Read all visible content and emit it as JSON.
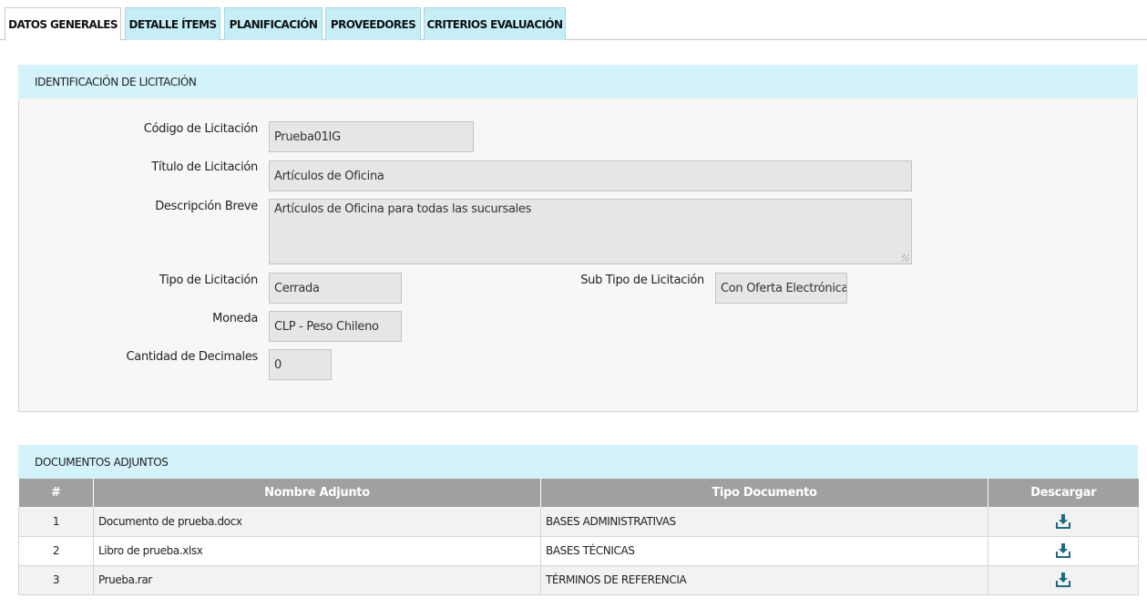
{
  "tabs": [
    {
      "label": "DATOS GENERALES",
      "active": true
    },
    {
      "label": "DETALLE ÍTEMS",
      "active": false
    },
    {
      "label": "PLANIFICACIÓN",
      "active": false
    },
    {
      "label": "PROVEEDORES",
      "active": false
    },
    {
      "label": "CRITERIOS EVALUACIÓN",
      "active": false
    }
  ],
  "identificacion": {
    "header": "IDENTIFICACIÓN DE LICITACIÓN",
    "codigo_label": "Código de Licitación",
    "codigo_value": "Prueba01IG",
    "titulo_label": "Título de Licitación",
    "titulo_value": "Artículos de Oficina",
    "descripcion_label": "Descripción Breve",
    "descripcion_value": "Artículos de Oficina para todas las sucursales",
    "tipo_label": "Tipo de Licitación",
    "tipo_value": "Cerrada",
    "subtipo_label": "Sub Tipo de Licitación",
    "subtipo_value": "Con Oferta Electrónica",
    "moneda_label": "Moneda",
    "moneda_value": "CLP - Peso Chileno",
    "decimales_label": "Cantidad de Decimales",
    "decimales_value": "0"
  },
  "documentos": {
    "header": "DOCUMENTOS ADJUNTOS",
    "columns": [
      "#",
      "Nombre Adjunto",
      "Tipo Documento",
      "Descargar"
    ],
    "rows": [
      {
        "num": "1",
        "nombre": "Documento de prueba.docx",
        "tipo": "BASES ADMINISTRATIVAS",
        "icon": "download-icon"
      },
      {
        "num": "2",
        "nombre": "Libro de prueba.xlsx",
        "tipo": "BASES TÉCNICAS",
        "icon": "download-icon"
      },
      {
        "num": "3",
        "nombre": "Prueba.rar",
        "tipo": "TÉRMINOS DE REFERENCIA",
        "icon": "download-icon"
      }
    ]
  },
  "colors": {
    "tab_bg": "#c6eef7",
    "panel_header_bg": "#d3f2f9",
    "table_header_bg": "#a0a0a0",
    "download_icon": "#1b6b86"
  }
}
